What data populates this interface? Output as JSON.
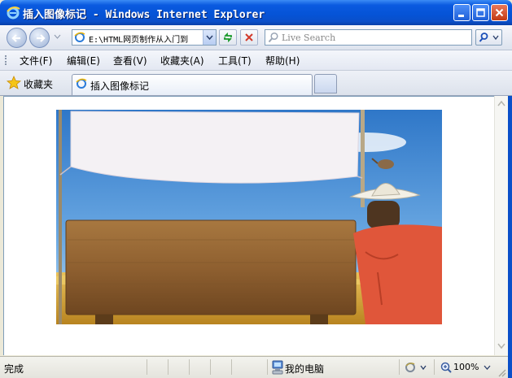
{
  "window": {
    "title": "插入图像标记 - Windows Internet Explorer"
  },
  "address_bar": {
    "url": "E:\\HTML网页制作从入门到"
  },
  "search": {
    "placeholder": "Live Search"
  },
  "menu": {
    "items": [
      "文件(F)",
      "编辑(E)",
      "查看(V)",
      "收藏夹(A)",
      "工具(T)",
      "帮助(H)"
    ]
  },
  "favorites": {
    "label": "收藏夹"
  },
  "tabs": [
    {
      "label": "插入图像标记",
      "active": true
    }
  ],
  "content": {
    "image_description_icon": "scarecrow-signboard-image"
  },
  "status": {
    "text": "完成",
    "zone": "我的电脑",
    "zoom": "100%"
  },
  "colors": {
    "titlebar": "#0553d6",
    "close_button": "#c33a14",
    "sky": "#4a8fd6",
    "wheat": "#d8a53a",
    "board": "#9a6a34",
    "scarecrow_shirt": "#e0563a"
  }
}
